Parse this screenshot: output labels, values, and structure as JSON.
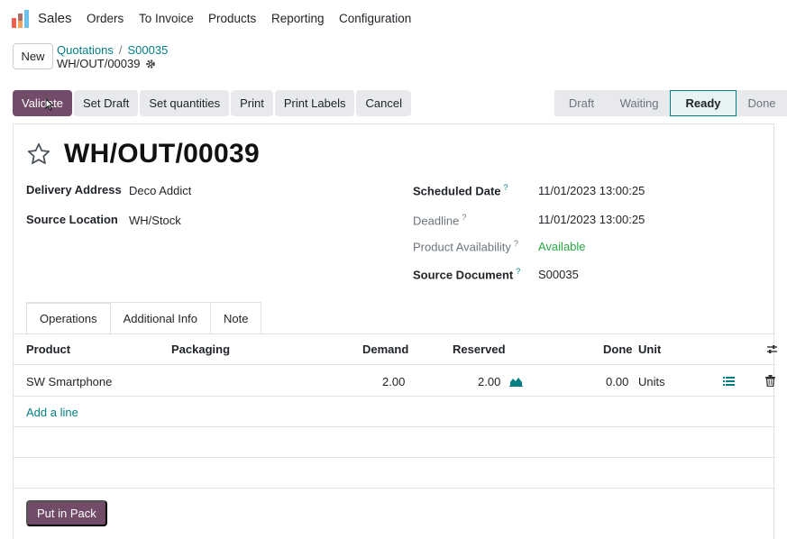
{
  "navbar": {
    "app_name": "Sales",
    "menus": [
      "Orders",
      "To Invoice",
      "Products",
      "Reporting",
      "Configuration"
    ]
  },
  "control": {
    "new_label": "New",
    "breadcrumb": [
      "Quotations",
      "S00035"
    ],
    "current": "WH/OUT/00039"
  },
  "actions": [
    "Validate",
    "Set Draft",
    "Set quantities",
    "Print",
    "Print Labels",
    "Cancel"
  ],
  "status": {
    "stages": [
      "Draft",
      "Waiting",
      "Ready",
      "Done"
    ],
    "active": "Ready"
  },
  "form": {
    "title": "WH/OUT/00039",
    "delivery_address_label": "Delivery Address",
    "delivery_address": "Deco Addict",
    "source_location_label": "Source Location",
    "source_location": "WH/Stock",
    "scheduled_date_label": "Scheduled Date",
    "scheduled_date": "11/01/2023 13:00:25",
    "deadline_label": "Deadline",
    "deadline": "11/01/2023 13:00:25",
    "availability_label": "Product Availability",
    "availability": "Available",
    "source_document_label": "Source Document",
    "source_document": "S00035",
    "help_mark": "?"
  },
  "tabs": [
    "Operations",
    "Additional Info",
    "Note"
  ],
  "table": {
    "headers": {
      "product": "Product",
      "packaging": "Packaging",
      "demand": "Demand",
      "reserved": "Reserved",
      "done": "Done",
      "unit": "Unit"
    },
    "rows": [
      {
        "product": "SW Smartphone",
        "demand": "2.00",
        "reserved": "2.00",
        "done": "0.00",
        "unit": "Units"
      }
    ],
    "add_line": "Add a line"
  },
  "footer": {
    "put_in_pack": "Put in Pack"
  },
  "colors": {
    "primary": "#714b67",
    "link": "#017e84",
    "success": "#28a745"
  }
}
